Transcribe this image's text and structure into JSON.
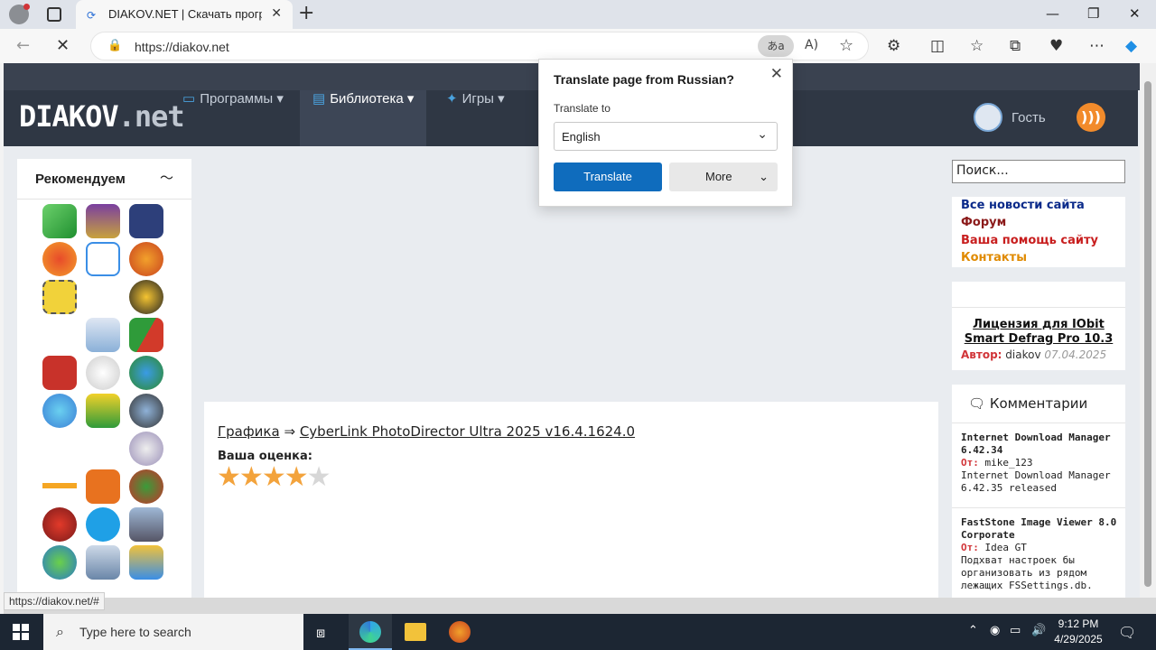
{
  "browser": {
    "tab_title": "DIAKOV.NET | Скачать программ",
    "url": "https://diakov.net",
    "translate_badge": "あa",
    "status_url": "https://diakov.net/#"
  },
  "site": {
    "logo_main": "DIAKOV",
    "logo_tld": ".net",
    "menu": [
      {
        "label": "Программы"
      },
      {
        "label": "Библиотека"
      },
      {
        "label": "Игры"
      }
    ],
    "guest_label": "Гость"
  },
  "recommend": {
    "title": "Рекомендуем"
  },
  "content": {
    "breadcrumb_category": "Графика",
    "breadcrumb_arrow": "⇒",
    "breadcrumb_title": "CyberLink PhotoDirector Ultra 2025 v16.4.1624.0",
    "rating_label": "Ваша оценка:",
    "rating": 4,
    "rating_max": 5
  },
  "sidebar": {
    "search_placeholder": "Поиск...",
    "links": [
      {
        "label": "Все новости сайта",
        "color": "#0a2a8a"
      },
      {
        "label": "Форум",
        "color": "#8b1a1a"
      },
      {
        "label": "Ваша помощь сайту",
        "color": "#c81e1e"
      },
      {
        "label": "Контакты",
        "color": "#e08a00"
      }
    ],
    "license_title": "Лицензия для IObit Smart Defrag Pro 10.3",
    "license_author_label": "Автор:",
    "license_author": "diakov",
    "license_date": "07.04.2025",
    "comments_title": "Комментарии",
    "comments": [
      {
        "title": "Internet Download Manager 6.42.34",
        "from_label": "От:",
        "from": "mike_123",
        "text": "Internet Download Manager 6.42.35 released"
      },
      {
        "title": "FastStone Image Viewer 8.0 Corporate",
        "from_label": "От:",
        "from": "Idea GT",
        "text": "Подхват настроек бы организовать из рядом лежащих FSSettings.db."
      }
    ]
  },
  "translate_popup": {
    "title": "Translate page from Russian?",
    "label": "Translate to",
    "selected_language": "English",
    "translate_button": "Translate",
    "more_button": "More"
  },
  "taskbar": {
    "search_placeholder": "Type here to search",
    "time": "9:12 PM",
    "date": "4/29/2025"
  },
  "colors": {
    "nav_bg": "#2f3744",
    "accent_blue": "#0f6cbd",
    "star": "#f3a33c"
  }
}
